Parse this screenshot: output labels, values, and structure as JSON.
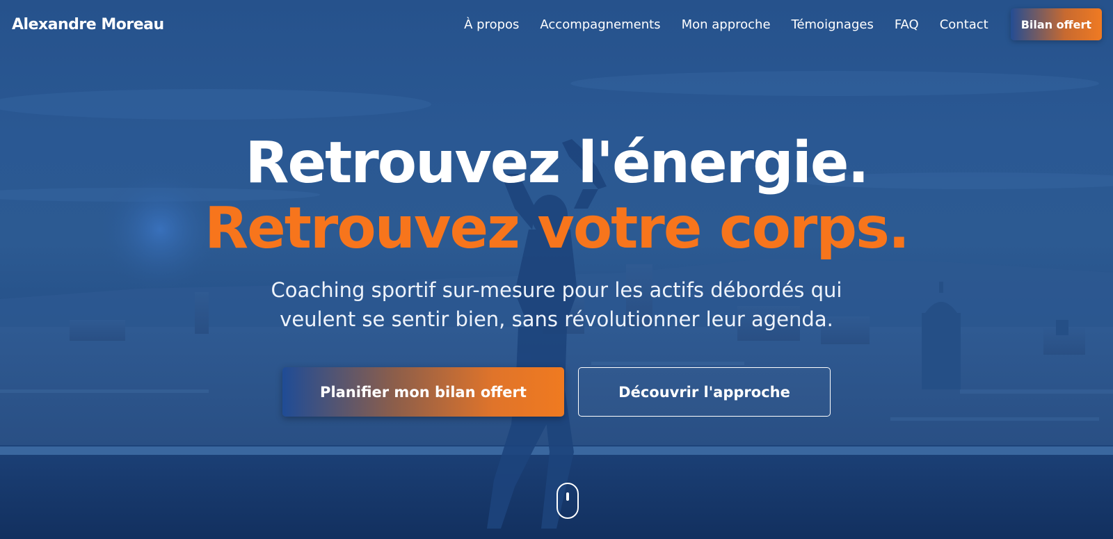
{
  "brand": {
    "name": "Alexandre Moreau"
  },
  "nav": {
    "links": [
      {
        "label": "À propos"
      },
      {
        "label": "Accompagnements"
      },
      {
        "label": "Mon approche"
      },
      {
        "label": "Témoignages"
      },
      {
        "label": "FAQ"
      },
      {
        "label": "Contact"
      }
    ],
    "cta_label": "Bilan offert"
  },
  "hero": {
    "headline_line1": "Retrouvez l'énergie.",
    "headline_line2": "Retrouvez votre corps.",
    "subtitle_line1": "Coaching sportif sur-mesure pour les actifs débordés qui",
    "subtitle_line2": "veulent se sentir bien, sans révolutionner leur agenda.",
    "primary_button": "Planifier mon bilan offert",
    "secondary_button": "Découvrir l'approche"
  },
  "colors": {
    "accent": "#f7751c",
    "overlay_blue": "#1e4a86",
    "text": "#ffffff"
  },
  "icons": {
    "scroll": "mouse-scroll-icon"
  }
}
